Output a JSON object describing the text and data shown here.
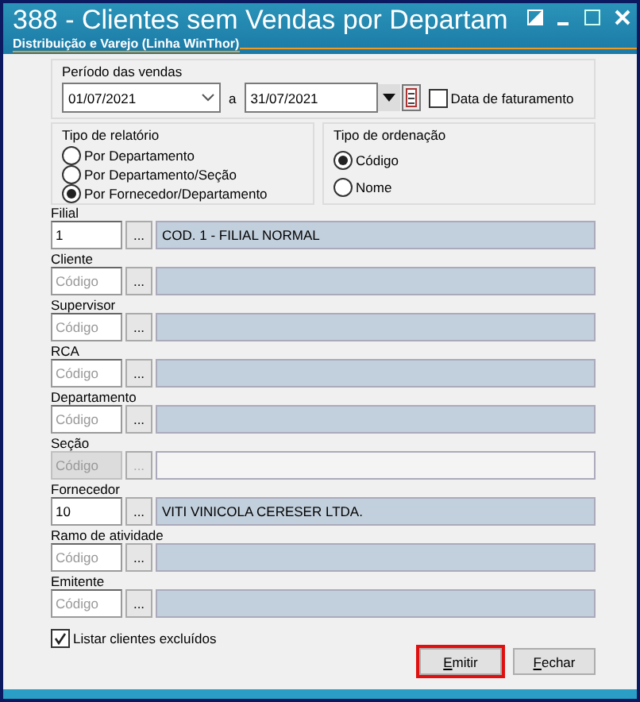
{
  "window": {
    "title": "388 - Clientes sem Vendas por Departam",
    "subtitle": "Distribuição e Varejo (Linha WinThor)"
  },
  "period": {
    "label": "Período das vendas",
    "start": "01/07/2021",
    "separator": "a",
    "end": "31/07/2021",
    "billing_date": {
      "label": "Data de faturamento",
      "checked": false
    }
  },
  "report_type": {
    "label": "Tipo de relatório",
    "options": [
      {
        "label": "Por Departamento",
        "selected": false
      },
      {
        "label": "Por Departamento/Seção",
        "selected": false
      },
      {
        "label": "Por Fornecedor/Departamento",
        "selected": true
      }
    ]
  },
  "sort_type": {
    "label": "Tipo de ordenação",
    "options": [
      {
        "label": "Código",
        "selected": true
      },
      {
        "label": "Nome",
        "selected": false
      }
    ]
  },
  "lookups": [
    {
      "label": "Filial",
      "value": "1",
      "button": "...",
      "description": "COD. 1 - FILIAL NORMAL",
      "disabled": false
    },
    {
      "label": "Cliente",
      "placeholder": "Código",
      "button": "...",
      "disabled": false
    },
    {
      "label": "Supervisor",
      "placeholder": "Código",
      "button": "...",
      "disabled": false
    },
    {
      "label": "RCA",
      "placeholder": "Código",
      "button": "...",
      "disabled": false
    },
    {
      "label": "Departamento",
      "placeholder": "Código",
      "button": "...",
      "disabled": false
    },
    {
      "label": "Seção",
      "placeholder": "Código",
      "button": "...",
      "disabled": true
    },
    {
      "label": "Fornecedor",
      "value": "10",
      "button": "...",
      "description": "VITI VINICOLA CERESER LTDA.",
      "disabled": false
    },
    {
      "label": "Ramo de atividade",
      "placeholder": "Código",
      "button": "...",
      "disabled": false
    },
    {
      "label": "Emitente",
      "placeholder": "Código",
      "button": "...",
      "disabled": false
    }
  ],
  "list_excluded": {
    "label": "Listar clientes excluídos",
    "checked": true
  },
  "buttons": [
    {
      "label": "Emitir",
      "highlighted": true
    },
    {
      "label": "Fechar",
      "highlighted": false
    }
  ]
}
